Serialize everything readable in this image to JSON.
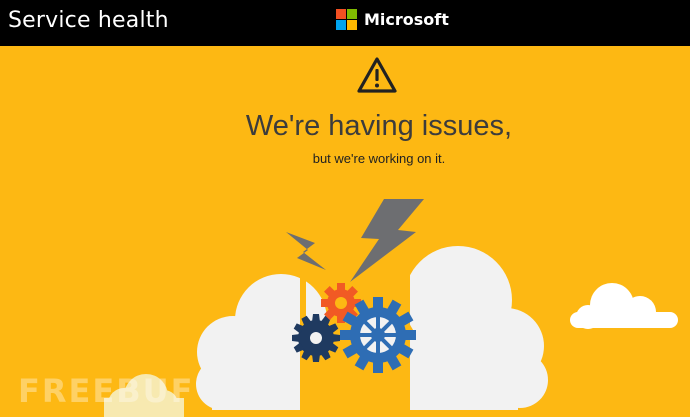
{
  "header": {
    "title": "Service health",
    "brand": "Microsoft"
  },
  "main": {
    "headline": "We're having issues,",
    "subline": "but we're working on it."
  },
  "watermark": "FREEBUF",
  "colors": {
    "background": "#FDB813",
    "topbar": "#000000",
    "logo_red": "#F25022",
    "logo_green": "#7FBA00",
    "logo_blue": "#00A4EF",
    "logo_yellow": "#FFB900",
    "gear_navy": "#1F3A60",
    "gear_orange": "#F15A24",
    "gear_blue": "#2E6DB4",
    "bolt": "#6D6E71",
    "cloud": "#F2F2F2"
  },
  "icons": [
    "warning-icon",
    "microsoft-logo",
    "lightning-bolt-icon",
    "gear-icon",
    "cloud-icon"
  ]
}
